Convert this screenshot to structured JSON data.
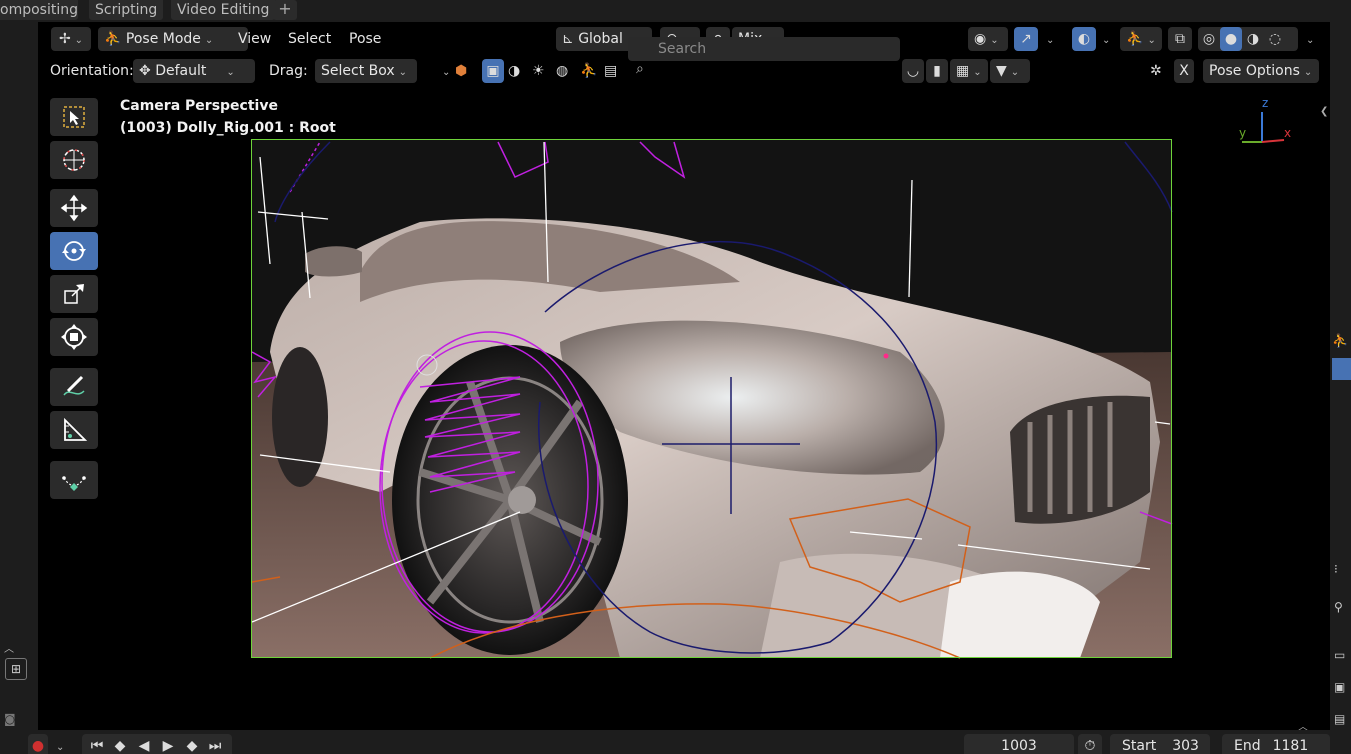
{
  "workspace_tabs": [
    "ompositing",
    "Scripting",
    "Video Editing"
  ],
  "header": {
    "mode": "Pose Mode",
    "menus": [
      "View",
      "Select",
      "Pose"
    ],
    "transform_orientation": "Global",
    "blend": "Mix"
  },
  "tool_settings": {
    "orientation_label": "Orientation:",
    "orientation_value": "Default",
    "drag_label": "Drag:",
    "drag_value": "Select Box",
    "search_placeholder": "Search",
    "x_label": "X",
    "pose_options": "Pose Options"
  },
  "viewport": {
    "camera_title": "Camera Perspective",
    "object_info": "(1003) Dolly_Rig.001 : Root",
    "gizmo_axes": {
      "z": "z",
      "y": "y",
      "x": "x"
    }
  },
  "toolbar": {
    "tools": [
      "select-box",
      "cursor",
      "move",
      "rotate",
      "scale",
      "transform",
      "annotate",
      "measure",
      "relax-pose"
    ],
    "active": "rotate"
  },
  "timeline": {
    "current_frame": "1003",
    "start_label": "Start",
    "start": "303",
    "end_label": "End",
    "end": "1181"
  },
  "colors": {
    "accent": "#4772b3",
    "camera_frame": "#6ed43a",
    "bone_magenta": "#c020e0",
    "bone_orange": "#d2601a",
    "bone_navy": "#1a1a6e"
  }
}
